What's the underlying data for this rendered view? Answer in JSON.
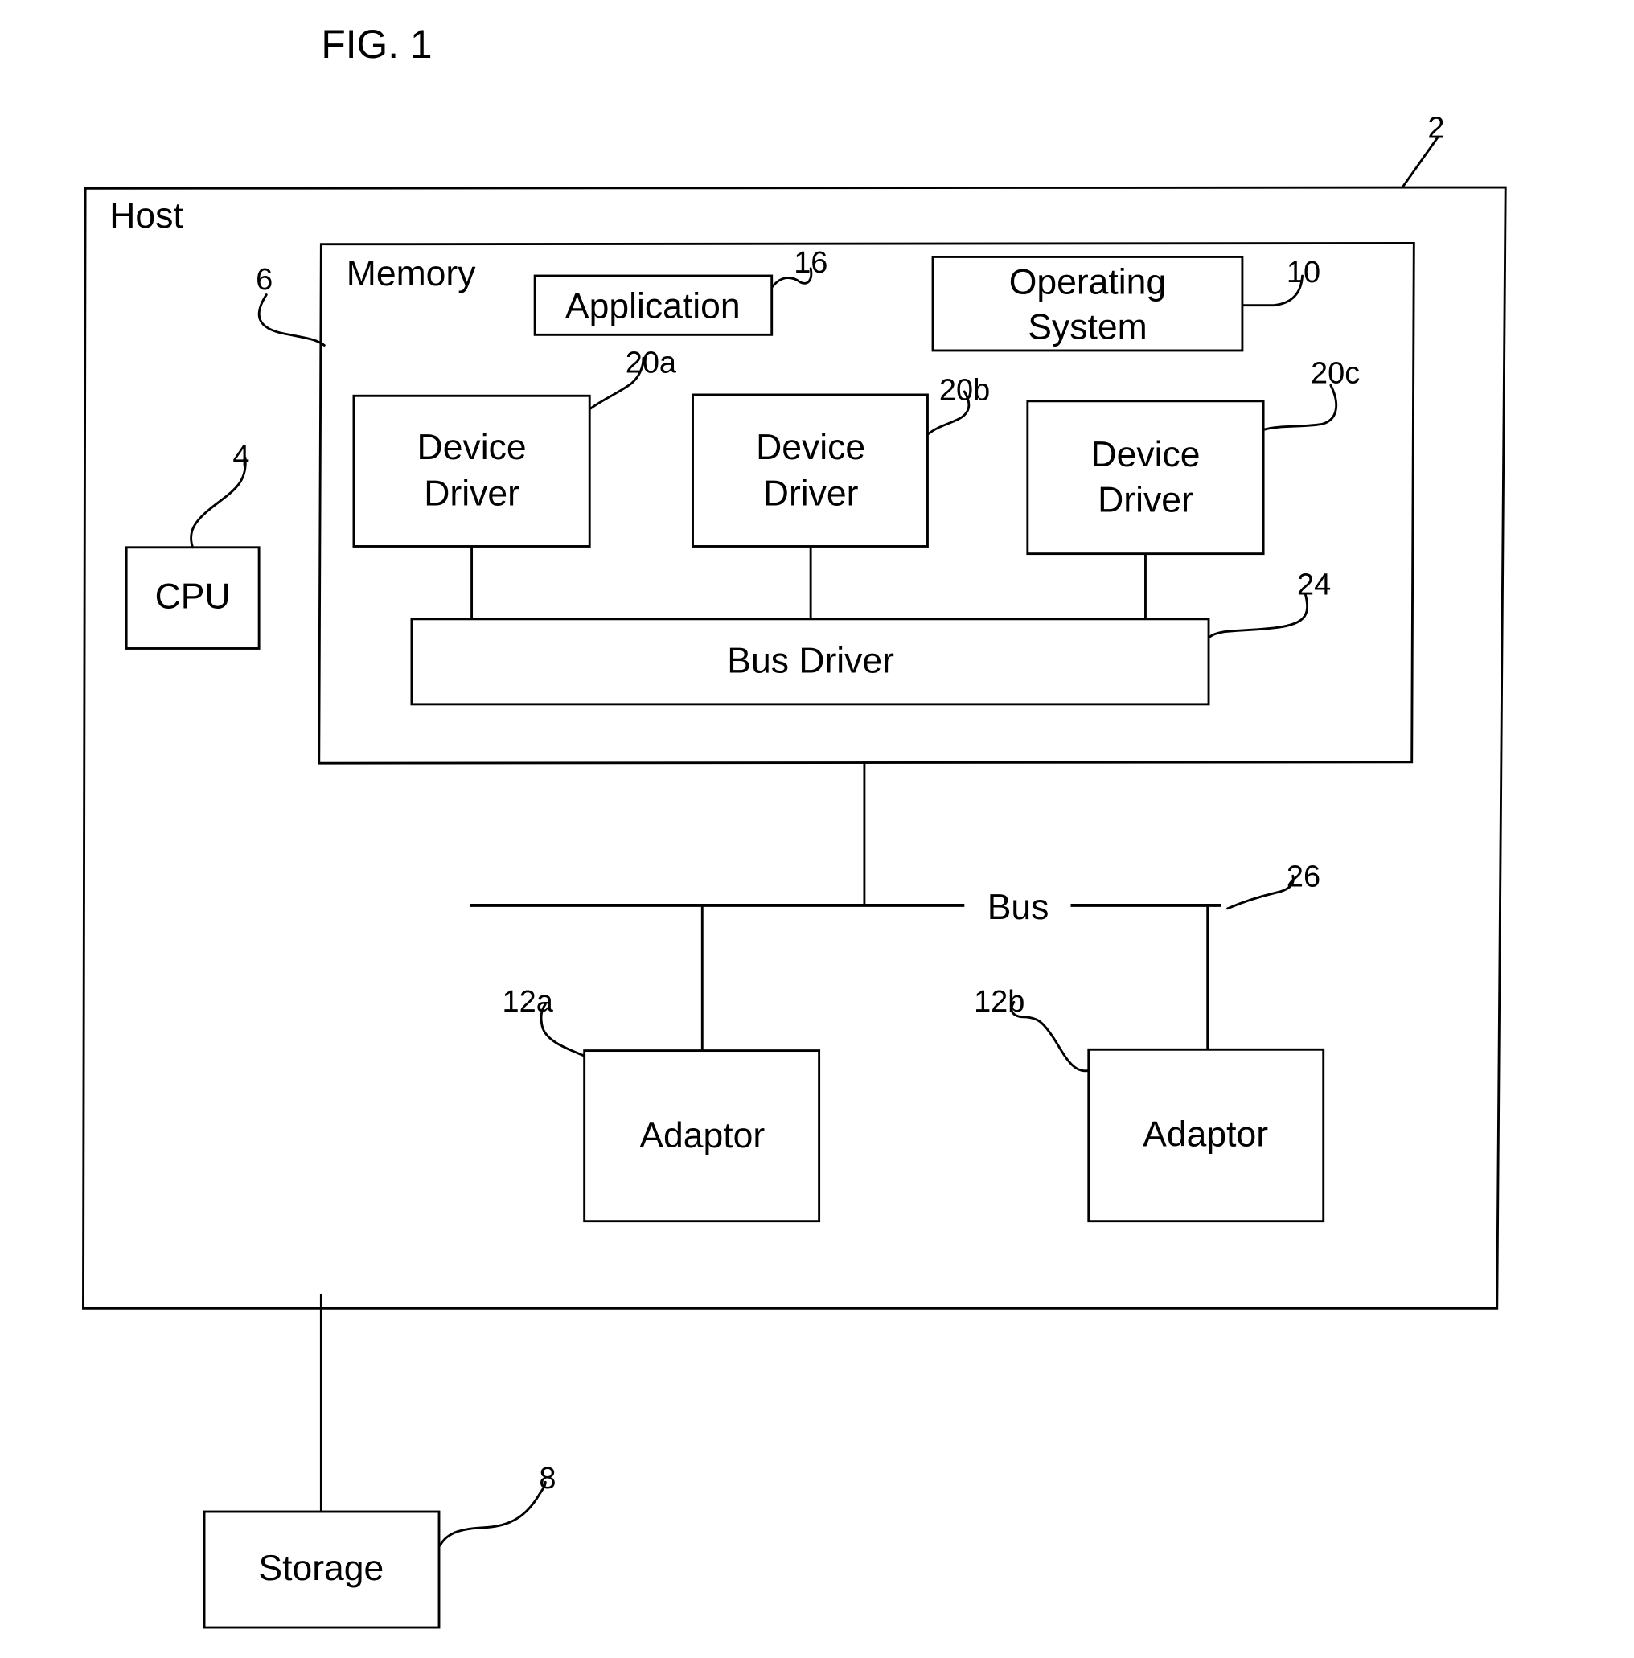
{
  "figure": {
    "title": "FIG. 1",
    "colors": {
      "ink": "#000000",
      "paper": "#ffffff"
    }
  },
  "host": {
    "label": "Host",
    "ref": "2"
  },
  "cpu": {
    "label": "CPU",
    "ref": "4"
  },
  "memory": {
    "label": "Memory",
    "ref": "6"
  },
  "storage": {
    "label": "Storage",
    "ref": "8"
  },
  "operating_system": {
    "label_line1": "Operating",
    "label_line2": "System",
    "ref": "10"
  },
  "application": {
    "label": "Application",
    "ref": "16"
  },
  "device_drivers": [
    {
      "label_line1": "Device",
      "label_line2": "Driver",
      "ref": "20a"
    },
    {
      "label_line1": "Device",
      "label_line2": "Driver",
      "ref": "20b"
    },
    {
      "label_line1": "Device",
      "label_line2": "Driver",
      "ref": "20c"
    }
  ],
  "bus_driver": {
    "label": "Bus Driver",
    "ref": "24"
  },
  "bus": {
    "label": "Bus",
    "ref": "26"
  },
  "adaptors": [
    {
      "label": "Adaptor",
      "ref": "12a"
    },
    {
      "label": "Adaptor",
      "ref": "12b"
    }
  ]
}
